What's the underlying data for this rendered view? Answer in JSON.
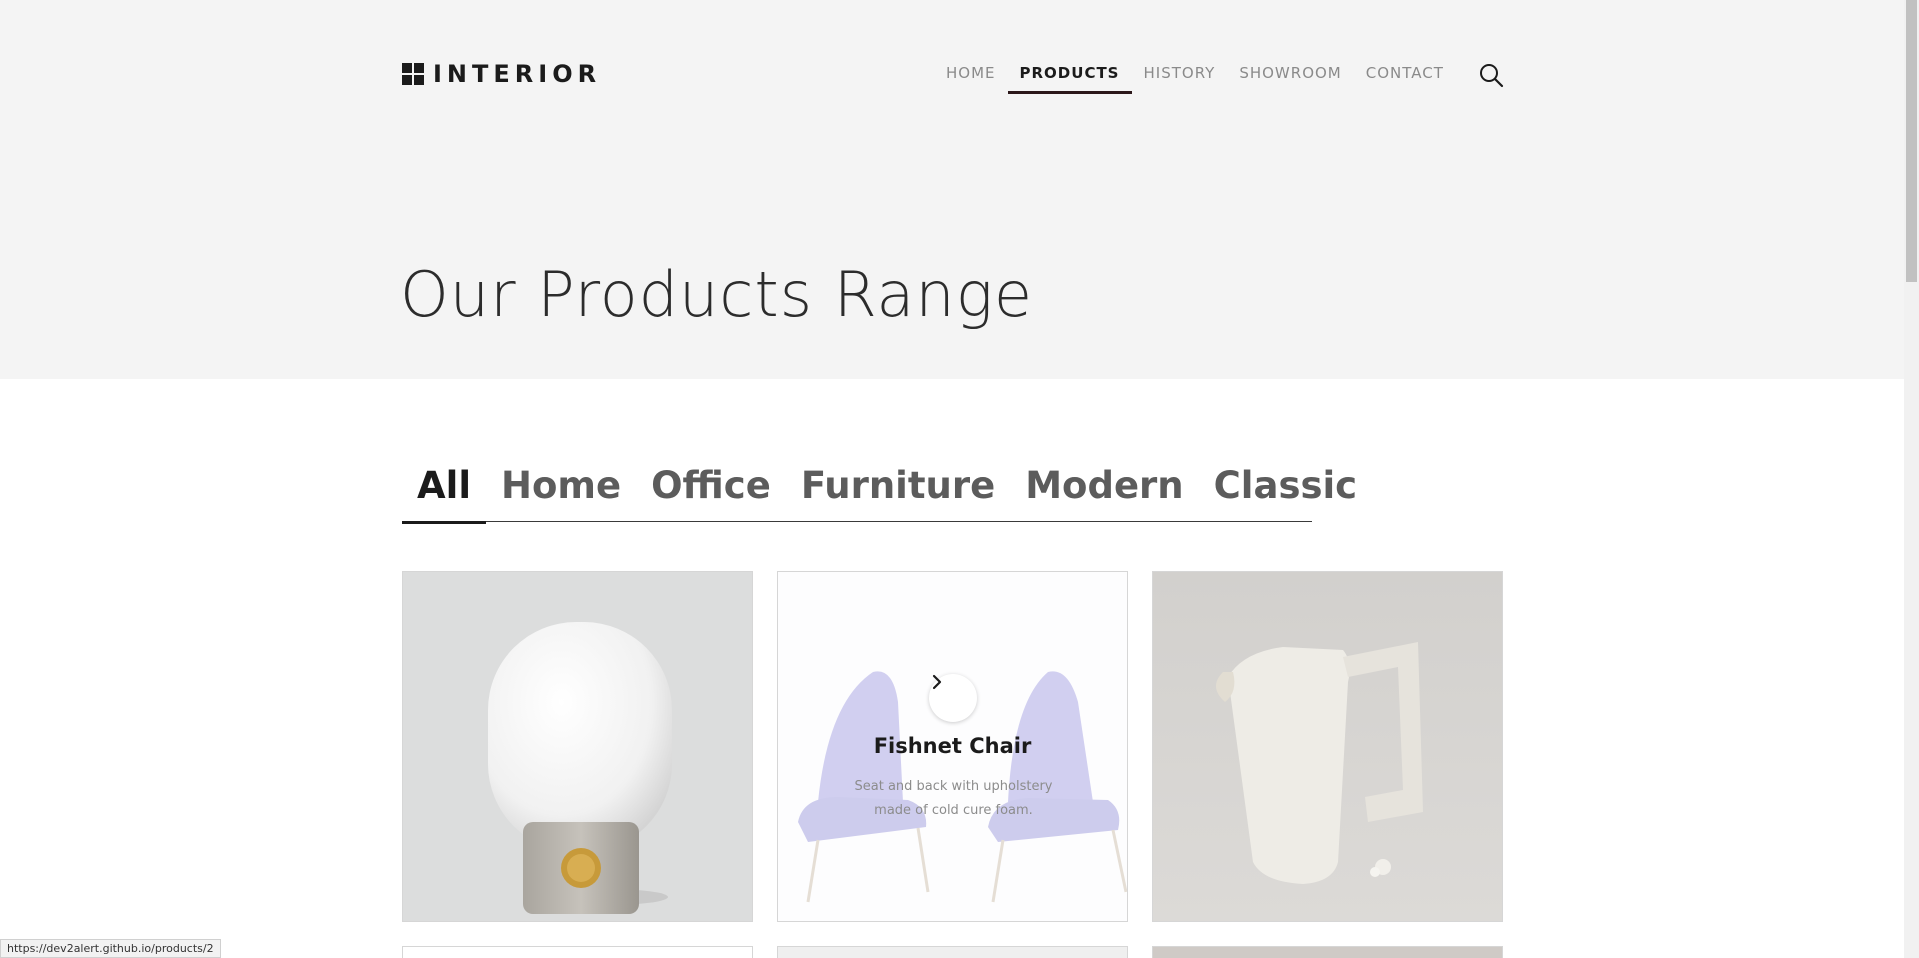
{
  "header": {
    "logo_text": "INTERIOR",
    "nav": [
      {
        "label": "HOME",
        "active": false
      },
      {
        "label": "PRODUCTS",
        "active": true
      },
      {
        "label": "HISTORY",
        "active": false
      },
      {
        "label": "SHOWROOM",
        "active": false
      },
      {
        "label": "CONTACT",
        "active": false
      }
    ],
    "search_icon": "search-icon"
  },
  "hero": {
    "title": "Our Products Range"
  },
  "filters": {
    "tabs": [
      {
        "label": "All",
        "active": true
      },
      {
        "label": "Home",
        "active": false
      },
      {
        "label": "Office",
        "active": false
      },
      {
        "label": "Furniture",
        "active": false
      },
      {
        "label": "Modern",
        "active": false
      },
      {
        "label": "Classic",
        "active": false
      }
    ]
  },
  "products": [
    {
      "image": "table-lamp",
      "hovered": false
    },
    {
      "image": "purple-chairs",
      "hovered": true,
      "title": "Fishnet Chair",
      "description": "Seat and back with upholstery made of cold cure foam.",
      "action_icon": "chevron-right-icon"
    },
    {
      "image": "ceramic-pitcher",
      "hovered": false
    }
  ],
  "status_bar": {
    "url": "https://dev2alert.github.io/products/2"
  },
  "colors": {
    "hero_bg": "#f4f4f4",
    "text_dark": "#1b1b1b",
    "nav_inactive": "#8a8a8a",
    "nav_underline": "#2b1719"
  }
}
